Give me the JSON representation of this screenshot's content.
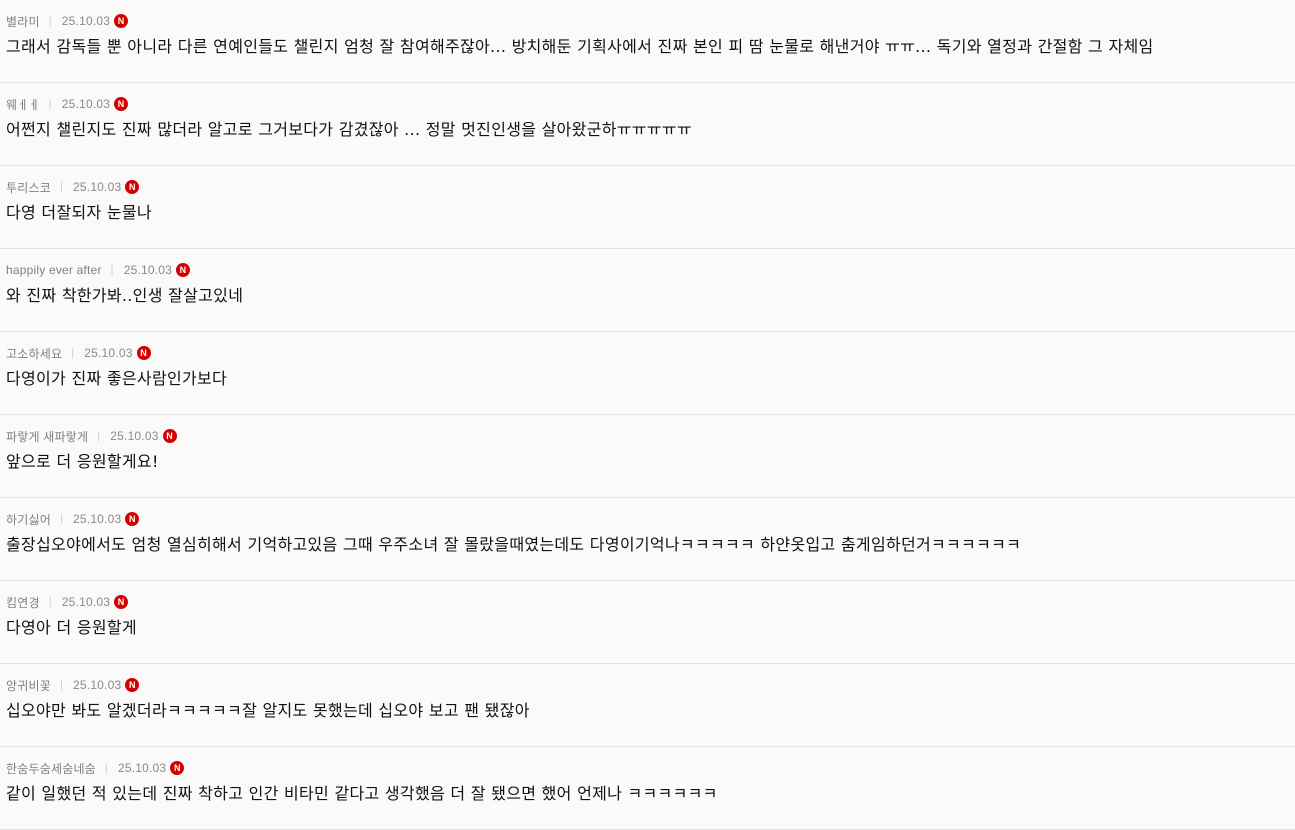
{
  "comments": [
    {
      "author": "별라미",
      "date": "25.10.03",
      "badge": "N",
      "text": "그래서 감독들 뿐 아니라 다른 연예인들도 챌린지 엄청 잘 참여해주잖아... 방치해둔 기획사에서 진짜 본인 피 땀 눈물로 해낸거야 ㅠㅠ... 독기와 열정과 간절함 그 자체임"
    },
    {
      "author": "웨ㅔㅔ",
      "date": "25.10.03",
      "badge": "N",
      "text": "어쩐지 챌린지도 진짜 많더라 알고로 그거보다가 감겼잖아 ... 정말 멋진인생을 살아왔군하ㅠㅠㅠㅠㅠ"
    },
    {
      "author": "투리스코",
      "date": "25.10.03",
      "badge": "N",
      "text": "다영 더잘되자 눈물나"
    },
    {
      "author": "happily ever after",
      "date": "25.10.03",
      "badge": "N",
      "text": "와 진짜 착한가봐..인생 잘살고있네"
    },
    {
      "author": "고소하세요",
      "date": "25.10.03",
      "badge": "N",
      "text": "다영이가 진짜 좋은사람인가보다"
    },
    {
      "author": "파랗게 새파랗게",
      "date": "25.10.03",
      "badge": "N",
      "text": "앞으로 더 응원할게요!"
    },
    {
      "author": "하기싫어",
      "date": "25.10.03",
      "badge": "N",
      "text": "출장십오야에서도 엄청 열심히해서 기억하고있음 그때 우주소녀 잘 몰랐을때였는데도 다영이기억나ㅋㅋㅋㅋㅋ 하얀옷입고 춤게임하던거ㅋㅋㅋㅋㅋㅋ"
    },
    {
      "author": "킴연경",
      "date": "25.10.03",
      "badge": "N",
      "text": "다영아 더 응원할게"
    },
    {
      "author": "앙귀비꽃",
      "date": "25.10.03",
      "badge": "N",
      "text": "십오야만 봐도 알겠더라ㅋㅋㅋㅋㅋ잘 알지도 못했는데 십오야 보고 팬 됐잖아"
    },
    {
      "author": "한숨두숨세숨네숨",
      "date": "25.10.03",
      "badge": "N",
      "text": "같이 일했던 적 있는데 진짜 착하고 인간 비타민 같다고 생각했음 더 잘 됐으면 했어 언제나 ㅋㅋㅋㅋㅋㅋ"
    }
  ]
}
